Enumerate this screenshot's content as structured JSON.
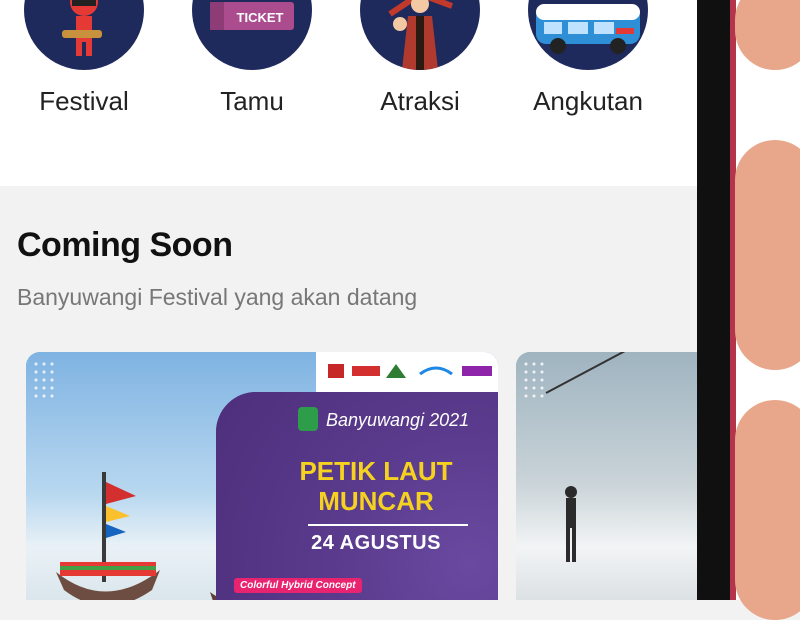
{
  "categories": [
    {
      "label": "Festival",
      "icon": "festival-mascot-icon"
    },
    {
      "label": "Tamu",
      "icon": "ticket-icon"
    },
    {
      "label": "Atraksi",
      "icon": "dancer-icon"
    },
    {
      "label": "Angkutan",
      "icon": "van-icon"
    }
  ],
  "ticket_text": "TICKET",
  "section": {
    "title": "Coming Soon",
    "subtitle": "Banyuwangi Festival yang akan datang"
  },
  "events": [
    {
      "brand": "Banyuwangi 2021",
      "headline_line1": "PETIK LAUT",
      "headline_line2": "MUNCAR",
      "date": "24 AGUSTUS",
      "tagline": "Colorful Hybrid Concept"
    }
  ],
  "colors": {
    "icon_circle": "#1f2a5c",
    "poster_purple": "#5a3a8c",
    "headline_yellow": "#f4d21f",
    "tag_pink": "#e8236f"
  }
}
